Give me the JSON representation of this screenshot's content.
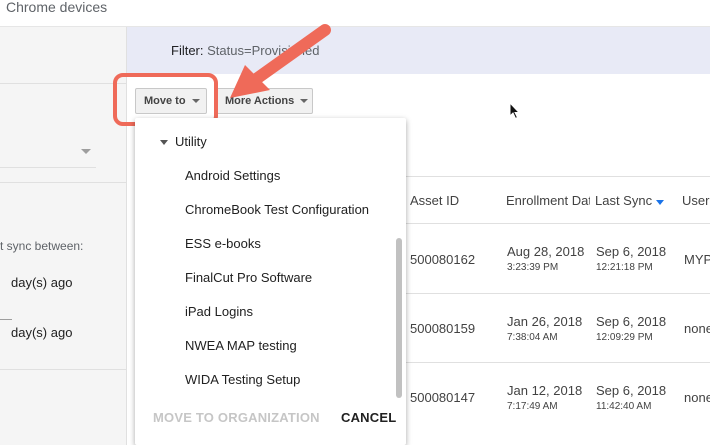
{
  "header": {
    "title": "Chrome devices"
  },
  "left_panel": {
    "sync_label": "t sync between:",
    "day1": "day(s) ago",
    "day2": "day(s) ago"
  },
  "filter": {
    "label": "Filter: ",
    "value": "Status=Provisioned"
  },
  "toolbar": {
    "move_to": "Move to",
    "more_actions": "More Actions"
  },
  "table": {
    "headers": [
      "Asset ID",
      "Enrollment Dat",
      "Last Sync",
      "User"
    ],
    "rows": [
      {
        "asset": "500080162",
        "enroll_date": "Aug 28, 2018",
        "enroll_time": "3:23:39 PM",
        "sync_date": "Sep 6, 2018",
        "sync_time": "12:21:18 PM",
        "user": "MYP"
      },
      {
        "asset": "500080159",
        "enroll_date": "Jan 26, 2018",
        "enroll_time": "7:38:04 AM",
        "sync_date": "Sep 6, 2018",
        "sync_time": "12:09:29 PM",
        "user": "none"
      },
      {
        "asset": "500080147",
        "enroll_date": "Jan 12, 2018",
        "enroll_time": "7:17:49 AM",
        "sync_date": "Sep 6, 2018",
        "sync_time": "11:42:40 AM",
        "user": "none"
      }
    ]
  },
  "dropdown": {
    "parent": "Utility",
    "items": [
      "Android Settings",
      "ChromeBook Test Configuration",
      "ESS e-books",
      "FinalCut Pro Software",
      "iPad Logins",
      "NWEA MAP testing",
      "WIDA Testing Setup"
    ],
    "move_action": "MOVE TO ORGANIZATION",
    "cancel_action": "CANCEL"
  },
  "colors": {
    "highlight": "#ef6a59",
    "filter_bg": "#e8eaf6",
    "sort_arrow": "#1a73e8"
  }
}
